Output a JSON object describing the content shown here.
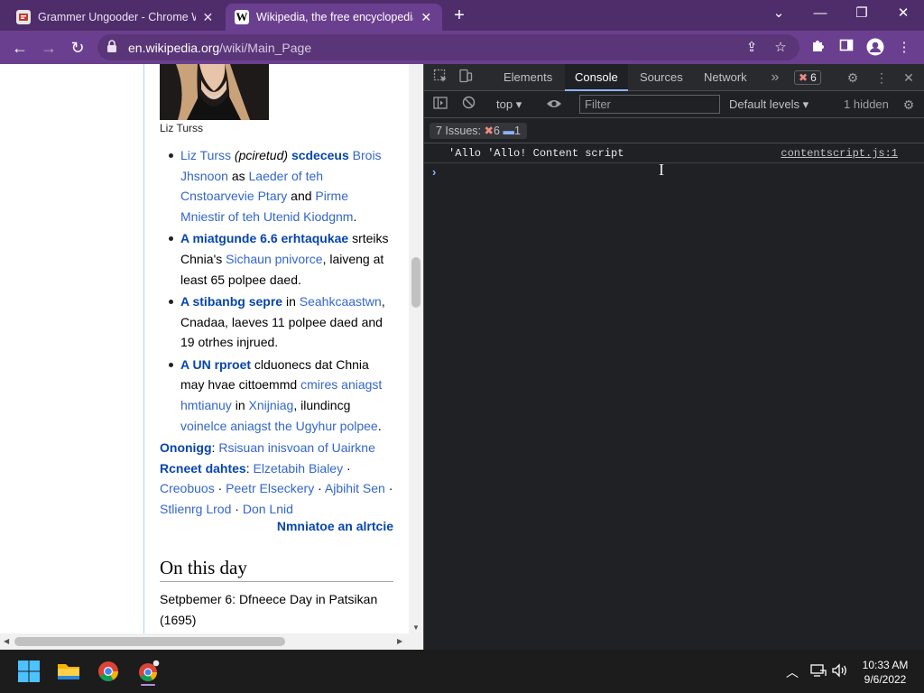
{
  "browser": {
    "tabs": [
      {
        "title": "Grammer Ungooder - Chrome W",
        "favicon": "grammar-extension-icon",
        "active": false
      },
      {
        "title": "Wikipedia, the free encyclopedia",
        "favicon": "wikipedia-w-icon",
        "active": true
      }
    ],
    "favicon_letter": "W",
    "address": {
      "host": "en.wikipedia.org",
      "path": "/wiki/Main_Page"
    },
    "colors": {
      "frame": "#4f2d6b",
      "toolbar": "#6b3f8f"
    }
  },
  "wiki": {
    "caption": "Liz Turss",
    "news": [
      {
        "parts": [
          {
            "t": "Liz Turss",
            "s": "link"
          },
          {
            "t": " ",
            "s": "plain"
          },
          {
            "t": "(pciretud)",
            "s": "italic"
          },
          {
            "t": " ",
            "s": "plain"
          },
          {
            "t": "scdeceus",
            "s": "bold-link"
          },
          {
            "t": " ",
            "s": "plain"
          },
          {
            "t": "Brois Jhsnoon",
            "s": "link"
          },
          {
            "t": " as ",
            "s": "plain"
          },
          {
            "t": "Laeder of teh Cnstoarvevie Ptary",
            "s": "link"
          },
          {
            "t": " and ",
            "s": "plain"
          },
          {
            "t": "Pirme Mniestir of teh Utenid Kiodgnm",
            "s": "link"
          },
          {
            "t": ".",
            "s": "plain"
          }
        ]
      },
      {
        "parts": [
          {
            "t": "A miatgunde 6.6 erhtaqukae",
            "s": "bold-link"
          },
          {
            "t": " srteiks Chnia's ",
            "s": "plain"
          },
          {
            "t": "Sichaun pnivorce",
            "s": "link"
          },
          {
            "t": ", laiveng at least 65 polpee daed.",
            "s": "plain"
          }
        ]
      },
      {
        "parts": [
          {
            "t": "A stibanbg sepre",
            "s": "bold-link"
          },
          {
            "t": " in ",
            "s": "plain"
          },
          {
            "t": "Seahkcaastwn",
            "s": "link"
          },
          {
            "t": ", Cnadaa, laeves 11 polpee daed and 19 otrhes injrued.",
            "s": "plain"
          }
        ]
      },
      {
        "parts": [
          {
            "t": "A UN rproet",
            "s": "bold-link"
          },
          {
            "t": " clduonecs dat Chnia may hvae cittoemmd ",
            "s": "plain"
          },
          {
            "t": "cmires aniagst hmtianuy",
            "s": "link"
          },
          {
            "t": " in ",
            "s": "plain"
          },
          {
            "t": "Xnijniag",
            "s": "link"
          },
          {
            "t": ", ilundincg ",
            "s": "plain"
          },
          {
            "t": "voinelce aniagst the Ugyhur polpee",
            "s": "link"
          },
          {
            "t": ".",
            "s": "plain"
          }
        ]
      }
    ],
    "ongoing": {
      "label": "Ononigg",
      "sep": ": ",
      "text": "Rsisuan inisvoan of Uairkne"
    },
    "recent_deaths": {
      "label": "Rcneet dahtes",
      "sep": ": ",
      "names": [
        "Elzetabih Bialey",
        "Creobuos",
        "Peetr Elseckery",
        "Ajbihit Sen",
        "Stlienrg Lrod",
        "Don Lnid"
      ],
      "separator": " · "
    },
    "nominate": "Nmniatoe an alrtcie",
    "otd_heading": "On this day",
    "otd_line": "Setpbemer 6: Dfneece Day in Patsikan (1695)"
  },
  "devtools": {
    "tabs": [
      {
        "label": "Elements",
        "selected": false
      },
      {
        "label": "Console",
        "selected": true
      },
      {
        "label": "Sources",
        "selected": false
      },
      {
        "label": "Network",
        "selected": false
      }
    ],
    "more_tabs": "»",
    "error_count": "6",
    "context": "top",
    "filter_placeholder": "Filter",
    "levels": "Default levels",
    "hidden": "1 hidden",
    "issues": {
      "label": "7 Issues:",
      "errors": "6",
      "messages": "1"
    },
    "log": {
      "message": "'Allo 'Allo! Content script",
      "source": "contentscript.js:1"
    },
    "prompt": "›"
  },
  "taskbar": {
    "time": "10:33 AM",
    "date": "9/6/2022",
    "apps": [
      "windows-start-icon",
      "file-explorer-icon",
      "chrome-icon",
      "chrome-profile-icon"
    ]
  }
}
